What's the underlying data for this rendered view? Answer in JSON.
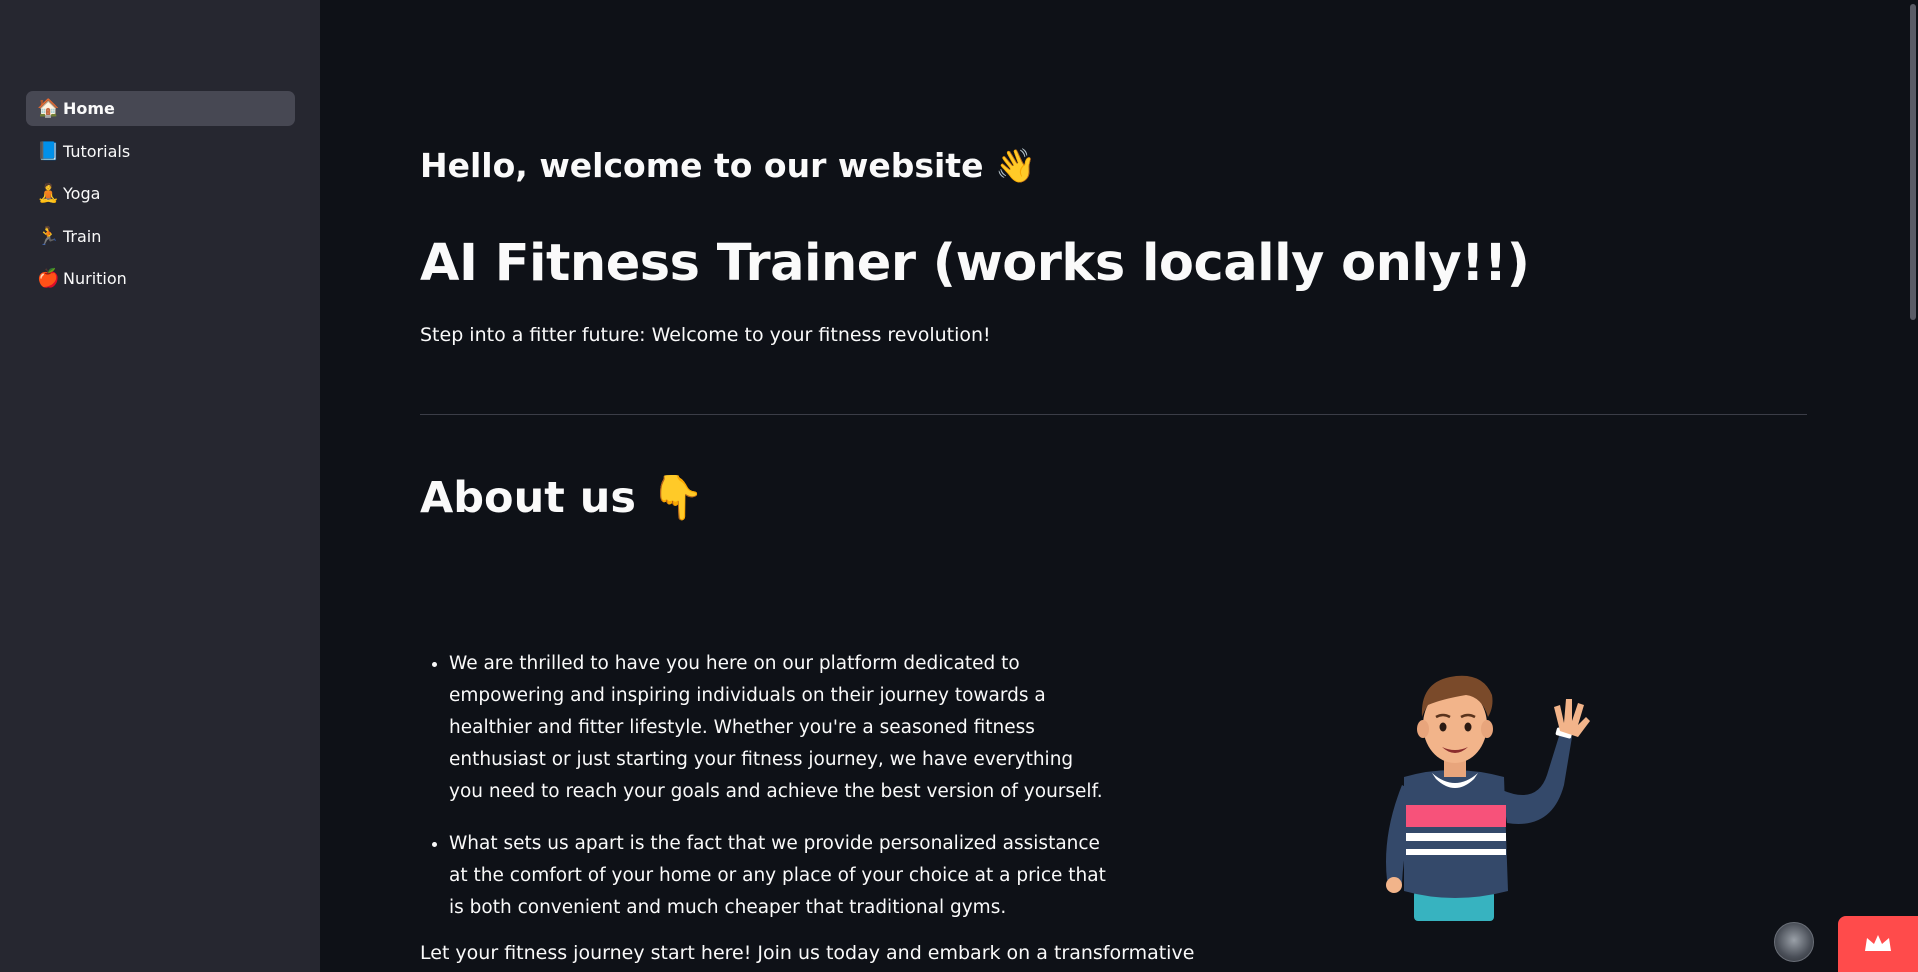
{
  "sidebar": {
    "items": [
      {
        "emoji": "🏠",
        "label": "Home",
        "active": true
      },
      {
        "emoji": "📘",
        "label": "Tutorials",
        "active": false
      },
      {
        "emoji": "🧘",
        "label": "Yoga",
        "active": false
      },
      {
        "emoji": "🏃",
        "label": "Train",
        "active": false
      },
      {
        "emoji": "🍎",
        "label": "Nurition",
        "active": false
      }
    ]
  },
  "main": {
    "welcome": "Hello, welcome to our website 👋",
    "title": "AI Fitness Trainer (works locally only!!)",
    "subtitle": "Step into a fitter future: Welcome to your fitness revolution!",
    "about_title": "About us 👇",
    "bullets": [
      "We are thrilled to have you here on our platform dedicated to empowering and inspiring individuals on their journey towards a healthier and fitter lifestyle. Whether you're a seasoned fitness enthusiast or just starting your fitness journey, we have everything you need to reach your goals and achieve the best version of yourself.",
      "What sets us apart is the fact that we provide personalized assistance at the comfort of your home or any place of your choice at a price that is both convenient and much cheaper that traditional gyms."
    ],
    "closing": "Let your fitness journey start here! Join us today and embark on a transformative"
  },
  "colors": {
    "background": "#0e1117",
    "sidebar": "#262730",
    "active_item": "#474853",
    "accent": "#ff4b4b",
    "text": "#fafafa"
  }
}
